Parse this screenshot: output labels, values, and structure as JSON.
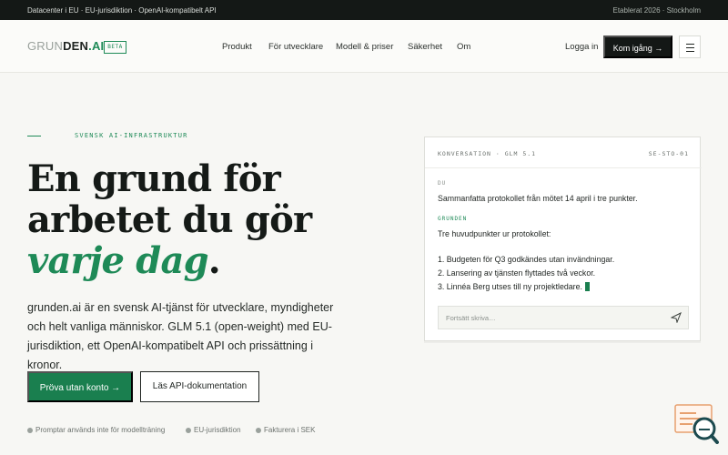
{
  "topbar": {
    "left": "Datacenter i EU · EU-jurisdiktion · OpenAI-kompatibelt API",
    "right": "Etablerat 2026 · Stockholm"
  },
  "nav": {
    "logo_part1": "GRUN",
    "logo_part2": "DEN",
    "logo_part3": ".AI",
    "badge": "BETA",
    "links": [
      "Produkt",
      "För utvecklare",
      "Modell & priser",
      "Säkerhet",
      "Om"
    ],
    "login": "Logga in",
    "cta": "Kom igång →"
  },
  "hero": {
    "kicker": "SVENSK AI-INFRASTRUKTUR",
    "line1": "En grund för",
    "line2": "arbetet du gör",
    "line3_green": "varje dag",
    "line3_tail": ".",
    "lede": "grunden.ai är en svensk AI-tjänst för utvecklare, myndigheter och helt vanliga människor. GLM 5.1 (open-weight) med EU-jurisdiktion, ett OpenAI-kompatibelt API och prissättning i kronor.",
    "primary_button": "Pröva utan konto →",
    "secondary_button": "Läs API-dokumentation",
    "features": [
      "Promptar används inte för modellträning",
      "EU-jurisdiktion",
      "Fakturera i SEK"
    ]
  },
  "chat": {
    "header_left": "KONVERSATION · GLM 5.1",
    "header_right": "SE-STO-01",
    "user_role": "DU",
    "user_message": "Sammanfatta protokollet från mötet 14 april i tre punkter.",
    "ai_role": "GRUNDEN",
    "ai_intro": "Tre huvudpunkter ur protokollet:",
    "ai_points": [
      "1. Budgeten för Q3 godkändes utan invändningar.",
      "2. Lansering av tjänsten flyttades två veckor.",
      "3. Linnéa Berg utses till ny projektledare."
    ],
    "input_placeholder": "Fortsätt skriva…"
  },
  "colors": {
    "accent": "#1e8a57",
    "dark": "#141816",
    "background": "#f7f7f4"
  }
}
